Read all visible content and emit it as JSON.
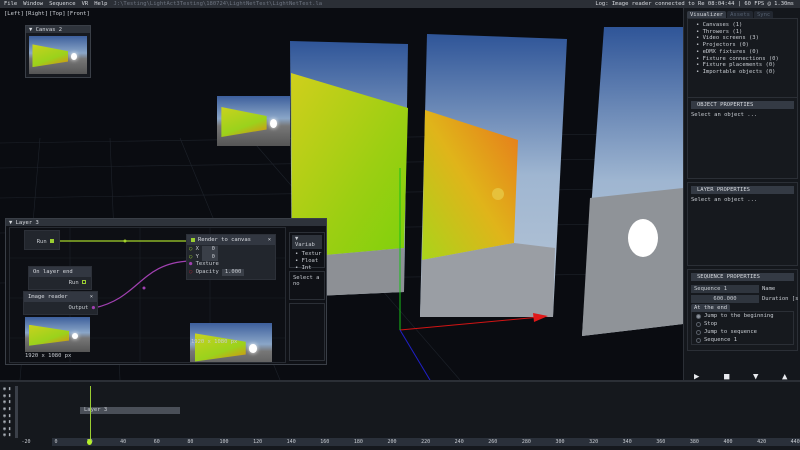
{
  "menu": {
    "items": [
      "File",
      "Window",
      "Sequence",
      "VR",
      "Help"
    ],
    "path": "J:\\Testing\\LightAct3Testing\\180724\\LightNetTest\\LightNetTest.la",
    "log": "Log: Image reader connected to Re 08:04:44 | 60 FPS @ 1.30ms"
  },
  "viewport": {
    "buttons": [
      "[Left]",
      "[Right]",
      "[Top]",
      "[Front]"
    ]
  },
  "canvas_window": {
    "title": "Canvas 2"
  },
  "layer_window": {
    "title": "Layer 3",
    "run_label": "Run",
    "on_layer_end": {
      "title": "On layer end",
      "run": "Run"
    },
    "image_reader": {
      "title": "Image reader",
      "output": "Output",
      "resolution": "1920 x 1080 px",
      "close": "×"
    },
    "render_to_canvas": {
      "title": "Render to canvas",
      "x_label": "X",
      "x_value": "0",
      "y_label": "Y",
      "y_value": "0",
      "texture": "Texture",
      "opacity_label": "Opacity",
      "opacity_value": "1.000",
      "resolution": "1920 x 1080 px",
      "close": "×"
    },
    "variables": {
      "title": "Variab",
      "items": [
        "Textur",
        "Float",
        "Int"
      ],
      "select": "Select a no"
    }
  },
  "right_panel": {
    "tabs": [
      "Visualizer",
      "Assets",
      "Sync"
    ],
    "tree": [
      "Canvases (1)",
      "Throwers (1)",
      "Video screens (3)",
      "Projectors (0)",
      "eDMX fixtures (0)",
      "Fixture connections (0)",
      "Fixture placements (0)",
      "Importable objects (0)"
    ],
    "object_properties": {
      "title": "OBJECT PROPERTIES",
      "hint": "Select an object ..."
    },
    "layer_properties": {
      "title": "LAYER PROPERTIES",
      "hint": "Select an object ..."
    },
    "sequence_properties": {
      "title": "SEQUENCE PROPERTIES",
      "name_value": "Sequence 1",
      "name_label": "Name",
      "duration_value": "600.000",
      "duration_label": "Duration [s",
      "at_end_tab": "At the end",
      "options": [
        {
          "label": "Jump to the beginning",
          "selected": true
        },
        {
          "label": "Stop",
          "selected": false
        },
        {
          "label": "Jump to sequence",
          "selected": false
        },
        {
          "label": "Sequence 1",
          "selected": false
        }
      ]
    },
    "controls": {
      "play": "▶",
      "stop": "■",
      "down": "▼",
      "up": "▲"
    }
  },
  "timeline": {
    "layer_bar": "Layer 3",
    "ticks": [
      "-20",
      "0",
      "20",
      "40",
      "60",
      "80",
      "100",
      "120",
      "140",
      "160",
      "180",
      "200",
      "220",
      "240",
      "260",
      "280",
      "300",
      "320",
      "340",
      "360",
      "380",
      "400",
      "420",
      "440"
    ],
    "playhead": 20,
    "accent": "#9acd32"
  }
}
